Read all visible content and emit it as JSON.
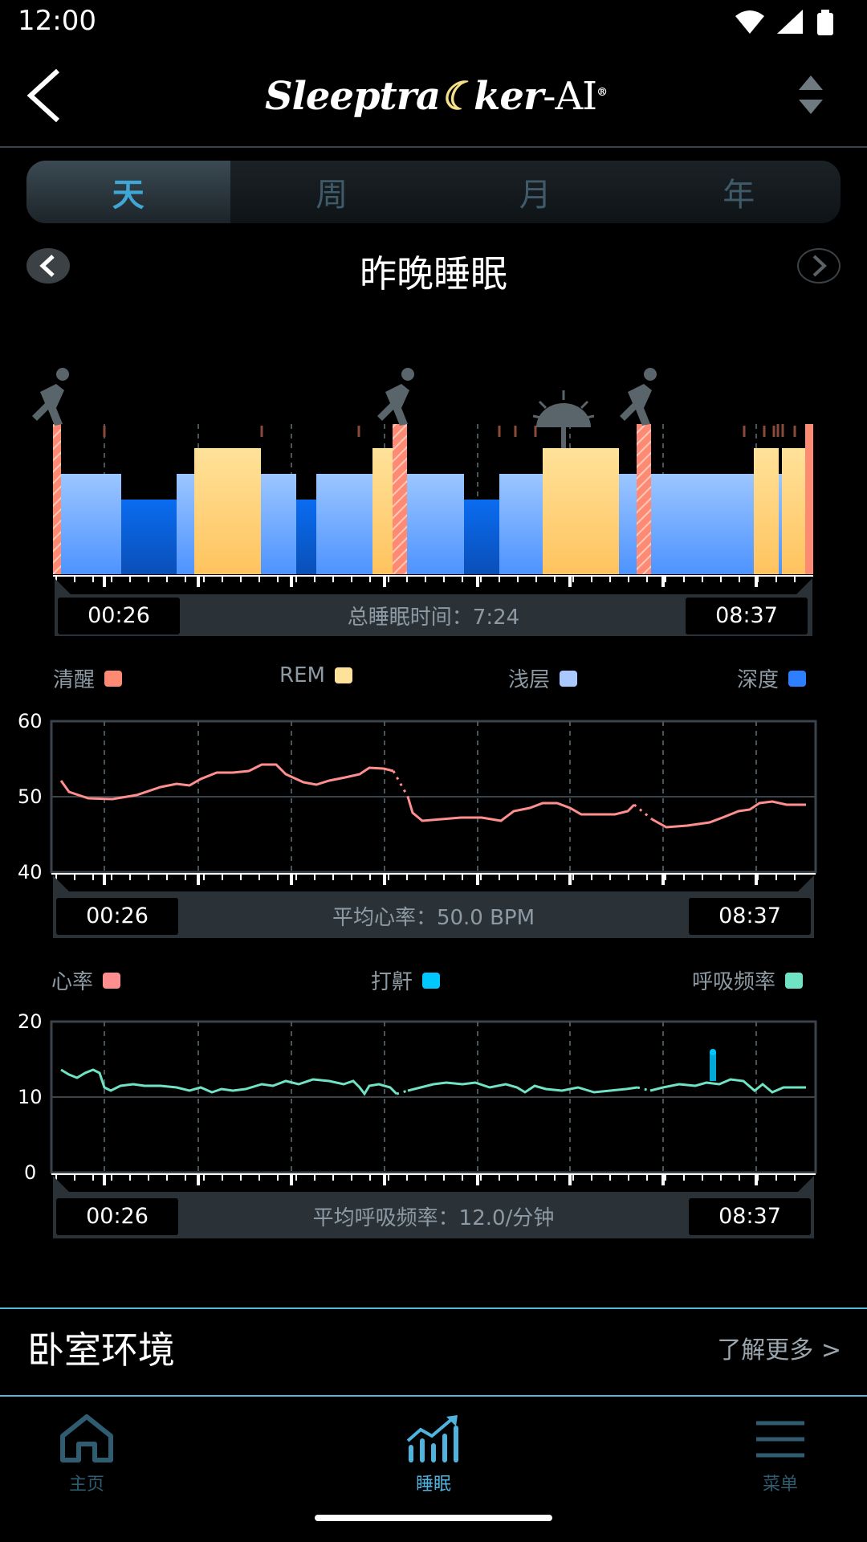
{
  "status_bar": {
    "time": "12:00"
  },
  "header": {
    "logo_text": "Sleeptra",
    "logo_text_2": "ker",
    "logo_suffix": "-AI",
    "logo_reg": "®"
  },
  "tabs": [
    {
      "label": "天",
      "active": true
    },
    {
      "label": "周",
      "active": false
    },
    {
      "label": "月",
      "active": false
    },
    {
      "label": "年",
      "active": false
    }
  ],
  "night_title": "昨晚睡眠",
  "sleep_stages": {
    "start_time": "00:26",
    "end_time": "08:37",
    "summary": "总睡眠时间：7:24",
    "legend": [
      {
        "label": "清醒",
        "color": "#ff7f6e"
      },
      {
        "label": "REM",
        "color": "#ffd98a"
      },
      {
        "label": "浅层",
        "color": "#a8c8ff"
      },
      {
        "label": "深度",
        "color": "#2e7fff"
      }
    ]
  },
  "heart_rate": {
    "y_ticks": [
      "60",
      "50",
      "40"
    ],
    "start_time": "00:26",
    "end_time": "08:37",
    "summary": "平均心率：50.0 BPM",
    "legend": [
      {
        "label": "心率",
        "color": "#ff8f8f"
      },
      {
        "label": "打鼾",
        "color": "#00c8ff"
      },
      {
        "label": "呼吸频率",
        "color": "#6fe3c3"
      }
    ]
  },
  "breathing": {
    "y_ticks": [
      "20",
      "10",
      "0"
    ],
    "start_time": "00:26",
    "end_time": "08:37",
    "summary": "平均呼吸频率：12.0/分钟"
  },
  "bedroom": {
    "title": "卧室环境",
    "more": "了解更多 >"
  },
  "bottom_nav": [
    {
      "label": "主页",
      "active": false,
      "icon": "home-icon"
    },
    {
      "label": "睡眠",
      "active": true,
      "icon": "sleep-chart-icon"
    },
    {
      "label": "菜单",
      "active": false,
      "icon": "menu-icon"
    }
  ],
  "colors": {
    "awake": "#ff8a74",
    "rem": "#ffd98a",
    "light": "#8dbaff",
    "deep": "#1f74f2",
    "heart_line": "#ff8f8f",
    "breath_line": "#6fe3c3",
    "accent": "#3fa6d6"
  }
}
